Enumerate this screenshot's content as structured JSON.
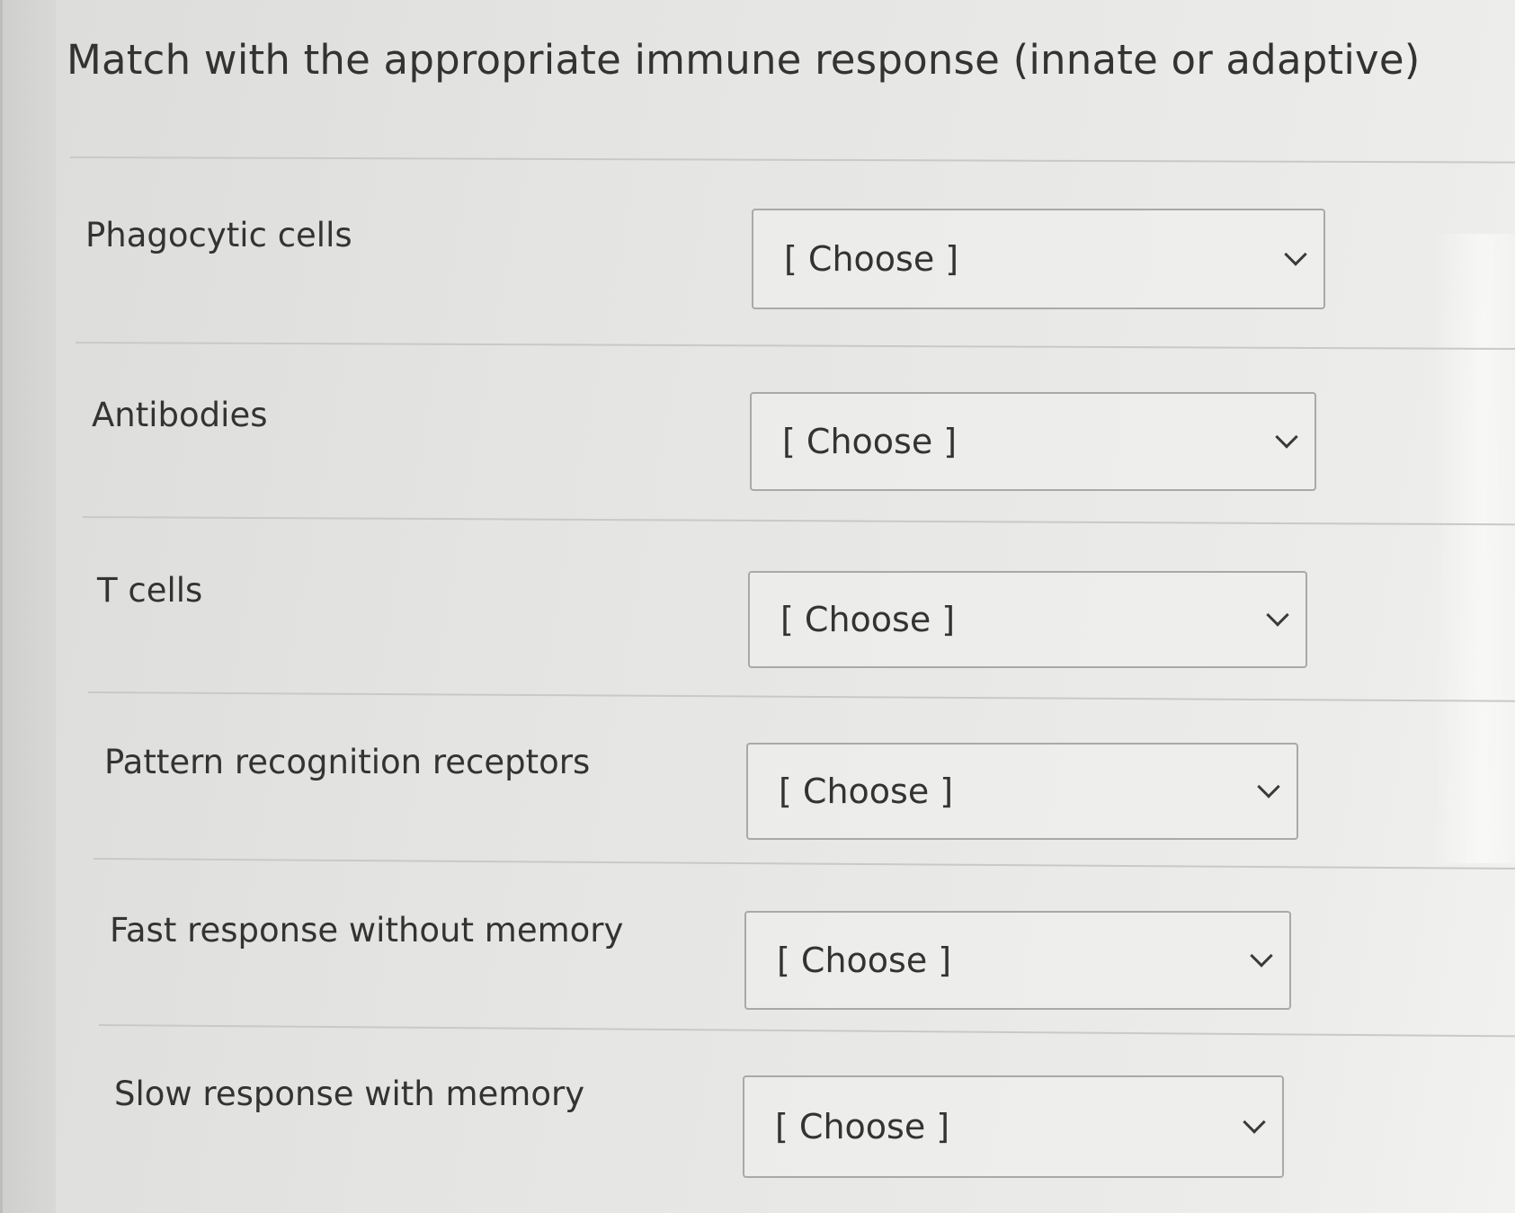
{
  "question": {
    "title": "Match with the appropriate immune response (innate or adaptive)"
  },
  "rows": [
    {
      "label": "Phagocytic cells",
      "select_value": "[ Choose ]"
    },
    {
      "label": "Antibodies",
      "select_value": "[ Choose ]"
    },
    {
      "label": "T cells",
      "select_value": "[ Choose ]"
    },
    {
      "label": "Pattern recognition receptors",
      "select_value": "[ Choose ]"
    },
    {
      "label": "Fast response without memory",
      "select_value": "[ Choose ]"
    },
    {
      "label": "Slow response with memory",
      "select_value": "[ Choose ]"
    }
  ]
}
